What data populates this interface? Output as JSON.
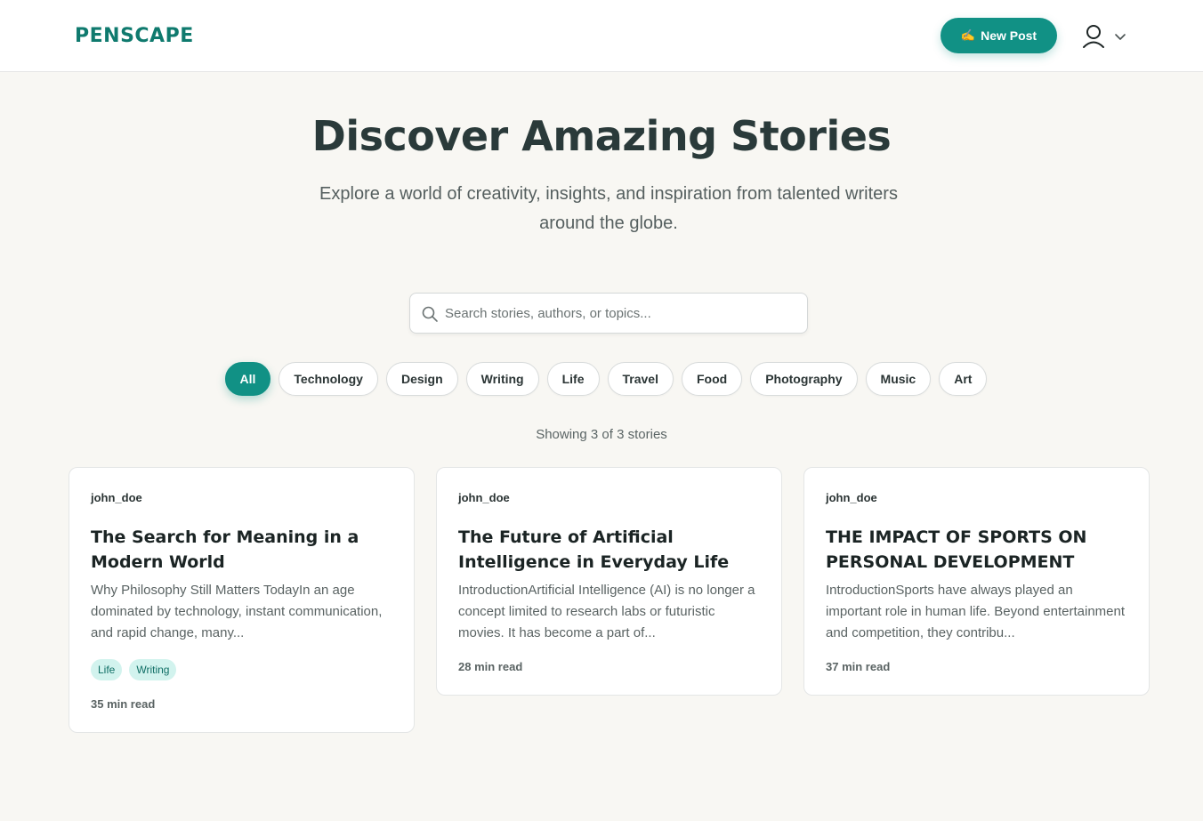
{
  "brand": {
    "logo": "PENSCAPE",
    "accent": "#119185"
  },
  "header": {
    "new_post_icon": "✍",
    "new_post_label": "New Post",
    "user_icon": "user-icon",
    "menu_icon": "chevron-down-icon"
  },
  "hero": {
    "title": "Discover Amazing Stories",
    "subtitle": "Explore a world of creativity, insights, and inspiration from talented writers around the globe."
  },
  "search": {
    "placeholder": "Search stories, authors, or topics...",
    "value": ""
  },
  "filters": [
    "All",
    "Technology",
    "Design",
    "Writing",
    "Life",
    "Travel",
    "Food",
    "Photography",
    "Music",
    "Art"
  ],
  "active_filter": "All",
  "results": {
    "text": "Showing 3 of 3 stories"
  },
  "stories": [
    {
      "author": "john_doe",
      "title": "The Search for Meaning in a Modern World",
      "excerpt": "Why Philosophy Still Matters TodayIn an age dominated by technology, instant communication, and rapid change, many...",
      "tags": [
        "Life",
        "Writing"
      ],
      "read_time": "35 min read"
    },
    {
      "author": "john_doe",
      "title": "The Future of Artificial Intelligence in Everyday Life",
      "excerpt": "IntroductionArtificial Intelligence (AI) is no longer a concept limited to research labs or futuristic movies. It has become a part of...",
      "tags": [],
      "read_time": "28 min read"
    },
    {
      "author": "john_doe",
      "title": "THE IMPACT OF SPORTS ON PERSONAL DEVELOPMENT",
      "excerpt": "IntroductionSports have always played an important role in human life. Beyond entertainment and competition, they contribu...",
      "tags": [],
      "read_time": "37 min read"
    }
  ]
}
